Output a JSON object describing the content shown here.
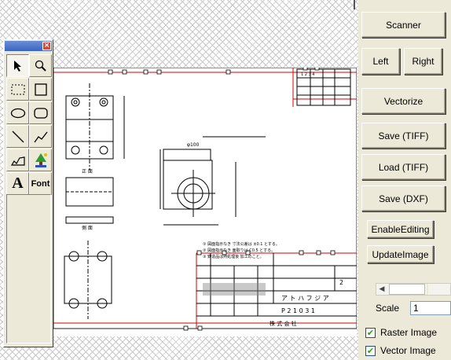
{
  "panel": {
    "scanner": "Scanner",
    "left": "Left",
    "right": "Right",
    "vectorize": "Vectorize",
    "save_tiff": "Save (TIFF)",
    "load_tiff": "Load (TIFF)",
    "save_dxf": "Save (DXF)",
    "enable_editing": "EnableEditing",
    "update_image": "UpdateImage",
    "scale_label": "Scale",
    "scale_value": "1",
    "raster_image": "Raster Image",
    "vector_image": "Vector Image",
    "raster_checked": true,
    "vector_checked": true
  },
  "toolbox": {
    "close_glyph": "×",
    "tools": [
      "pointer-tool",
      "zoom-tool",
      "dashed-rect-tool",
      "rect-tool",
      "ellipse-tool",
      "rounded-rect-tool",
      "line-tool",
      "polyline-tool",
      "freehand-tool",
      "fill-tool",
      "text-tool",
      "font-tool"
    ],
    "text_glyph": "A",
    "font_label": "Font"
  },
  "drawing": {
    "title_text": "株 式 会 社",
    "name_text": "ア ト ハ フ ジ ア",
    "part_no": "P 2 1 0 3 1",
    "sheet_digit": "2",
    "dim_top": "φ100",
    "note_line1": "① 図面指示なき 寸法公差は ±0.1 とする。",
    "note_line2": "② 図面指示なき 面取りは C0.5 とする。",
    "note_line3": "③ 鋳造品は熱処理後 加工のこと。",
    "label_a": "正 面",
    "label_b": "側 面"
  },
  "colors": {
    "accent_red": "#d40000",
    "panel_bg": "#ece9d8"
  }
}
